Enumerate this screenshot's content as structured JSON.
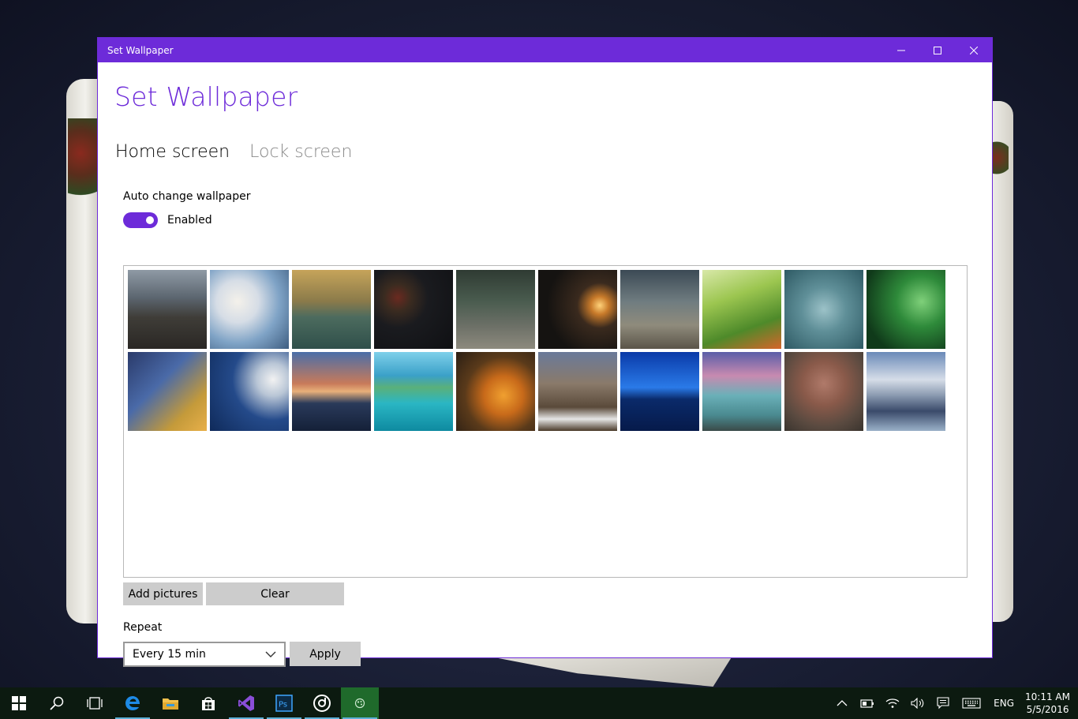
{
  "window": {
    "title": "Set Wallpaper",
    "accent": "#6d2bd9"
  },
  "app": {
    "title": "Set Wallpaper",
    "tabs": [
      {
        "label": "Home screen",
        "active": true
      },
      {
        "label": "Lock screen",
        "active": false
      }
    ],
    "auto_change_label": "Auto change wallpaper",
    "toggle_state": "Enabled",
    "add_pictures_label": "Add pictures",
    "clear_label": "Clear",
    "repeat_label": "Repeat",
    "repeat_selected": "Every 15 min",
    "apply_label": "Apply",
    "thumbnails": [
      {
        "theme": "white-car-on-hill"
      },
      {
        "theme": "clouds-and-sky"
      },
      {
        "theme": "island-with-tree"
      },
      {
        "theme": "potted-plants"
      },
      {
        "theme": "bokeh-street"
      },
      {
        "theme": "candle-light"
      },
      {
        "theme": "misty-blur"
      },
      {
        "theme": "green-grass"
      },
      {
        "theme": "water-drops"
      },
      {
        "theme": "green-glow"
      },
      {
        "theme": "autumn-branch"
      },
      {
        "theme": "cloud-blue-sky"
      },
      {
        "theme": "sunset-sea-rock"
      },
      {
        "theme": "tropical-lagoon"
      },
      {
        "theme": "orange-maple-leaf"
      },
      {
        "theme": "canyon"
      },
      {
        "theme": "blue-ocean-dusk"
      },
      {
        "theme": "misty-coast"
      },
      {
        "theme": "boulders"
      },
      {
        "theme": "snowy-mountains"
      }
    ]
  },
  "taskbar": {
    "items": [
      {
        "icon": "windows-start-icon"
      },
      {
        "icon": "search-icon"
      },
      {
        "icon": "task-view-icon"
      },
      {
        "icon": "edge-browser-icon",
        "active": true
      },
      {
        "icon": "file-explorer-icon"
      },
      {
        "icon": "store-icon"
      },
      {
        "icon": "visual-studio-icon",
        "active": true
      },
      {
        "icon": "photoshop-icon",
        "active": true
      },
      {
        "icon": "groove-music-icon",
        "active": true
      },
      {
        "icon": "set-wallpaper-app-icon",
        "active": true,
        "current": true
      }
    ],
    "tray": {
      "language": "ENG",
      "time": "10:11 AM",
      "date": "5/5/2016"
    }
  }
}
